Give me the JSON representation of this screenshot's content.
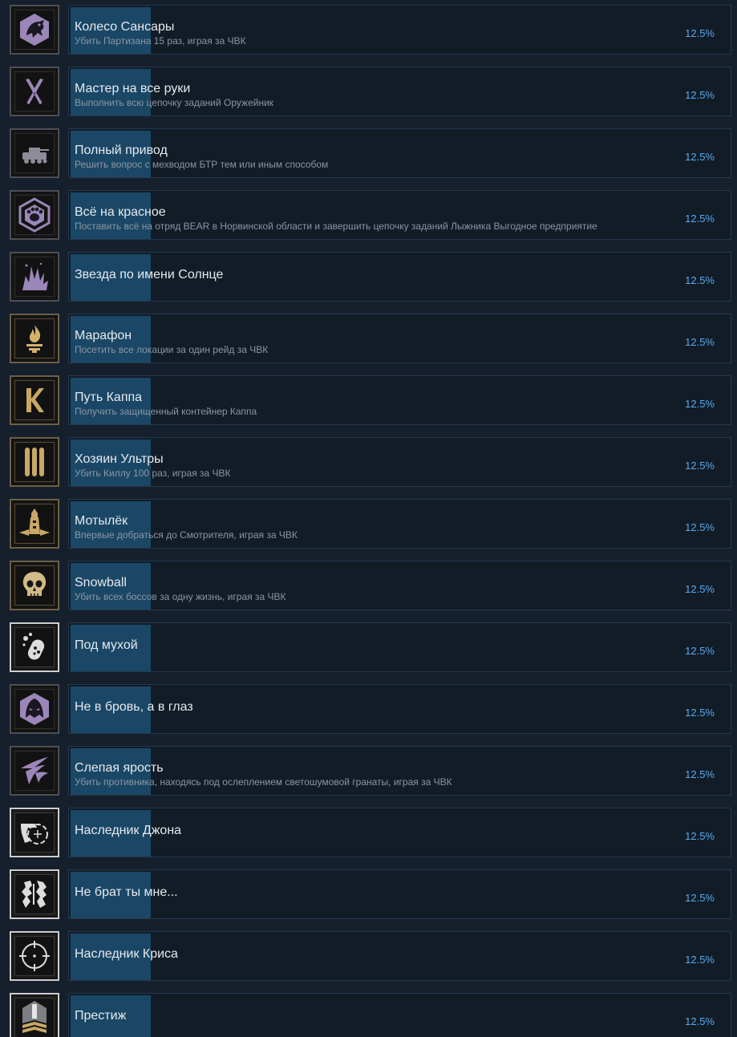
{
  "achievements": [
    {
      "title": "Колесо Сансары",
      "description": "Убить Партизана 15 раз, играя за ЧВК",
      "percent": "12.5%",
      "progress": 0.125,
      "icon": "partisan-raven-icon",
      "frame": "purple",
      "icon_color": "#9a86b8"
    },
    {
      "title": "Мастер на все руки",
      "description": "Выполнить всю цепочку заданий Оружейник",
      "percent": "12.5%",
      "progress": 0.125,
      "icon": "pliers-icon",
      "frame": "purple",
      "icon_color": "#9a86b8"
    },
    {
      "title": "Полный привод",
      "description": "Решить вопрос с мехводом БТР тем или иным способом",
      "percent": "12.5%",
      "progress": 0.125,
      "icon": "btr-vehicle-icon",
      "frame": "purple",
      "icon_color": "#8d8d99"
    },
    {
      "title": "Всё на красное",
      "description": "Поставить всё на отряд BEAR в Норвинской области и завершить цепочку заданий Лыжника Выгодное предприятие",
      "percent": "12.5%",
      "progress": 0.125,
      "icon": "bear-paw-hexagon-icon",
      "frame": "purple",
      "icon_color": "#9a86b8"
    },
    {
      "title": "Звезда по имени Солнце",
      "description": "",
      "percent": "12.5%",
      "progress": 0.125,
      "icon": "burst-explosion-icon",
      "frame": "purple",
      "icon_color": "#9a86b8"
    },
    {
      "title": "Марафон",
      "description": "Посетить все локации за один рейд за ЧВК",
      "percent": "12.5%",
      "progress": 0.125,
      "icon": "torch-flame-icon",
      "frame": "gold",
      "icon_color": "#d4b06a"
    },
    {
      "title": "Путь Каппа",
      "description": "Получить защищенный контейнер Каппа",
      "percent": "12.5%",
      "progress": 0.125,
      "icon": "kappa-icon",
      "frame": "gold",
      "icon_color": "#c8a866"
    },
    {
      "title": "Хозяин Ультры",
      "description": "Убить Киллу 100 раз, играя за ЧВК",
      "percent": "12.5%",
      "progress": 0.125,
      "icon": "triple-bars-icon",
      "frame": "gold",
      "icon_color": "#c8a866"
    },
    {
      "title": "Мотылёк",
      "description": "Впервые добраться до Смотрителя, играя за ЧВК",
      "percent": "12.5%",
      "progress": 0.125,
      "icon": "lighthouse-icon",
      "frame": "gold",
      "icon_color": "#c8a866"
    },
    {
      "title": "Snowball",
      "description": "Убить всех боссов за одну жизнь, играя за ЧВК",
      "percent": "12.5%",
      "progress": 0.125,
      "icon": "skull-icon",
      "frame": "gold",
      "icon_color": "#d2bb88"
    },
    {
      "title": "Под мухой",
      "description": "",
      "percent": "12.5%",
      "progress": 0.125,
      "icon": "pill-bubbles-icon",
      "frame": "silver",
      "icon_color": "#dcdcdc"
    },
    {
      "title": "Не в бровь, а в глаз",
      "description": "",
      "percent": "12.5%",
      "progress": 0.125,
      "icon": "hooded-face-hexagon-icon",
      "frame": "purple",
      "icon_color": "#9a86b8"
    },
    {
      "title": "Слепая ярость",
      "description": "Убить противника, находясь под ослеплением светошумовой гранаты, играя за ЧВК",
      "percent": "12.5%",
      "progress": 0.125,
      "icon": "claw-strike-icon",
      "frame": "purple",
      "icon_color": "#9a86b8"
    },
    {
      "title": "Наследник Джона",
      "description": "",
      "percent": "12.5%",
      "progress": 0.125,
      "icon": "pistol-crosshair-icon",
      "frame": "silver",
      "icon_color": "#dcdcdc"
    },
    {
      "title": "Не брат ты мне...",
      "description": "",
      "percent": "12.5%",
      "progress": 0.125,
      "icon": "torn-emblem-icon",
      "frame": "silver",
      "icon_color": "#dcdcdc"
    },
    {
      "title": "Наследник Криса",
      "description": "",
      "percent": "12.5%",
      "progress": 0.125,
      "icon": "sniper-scope-icon",
      "frame": "silver",
      "icon_color": "#dcdcdc"
    },
    {
      "title": "Престиж",
      "description": "",
      "percent": "12.5%",
      "progress": 0.125,
      "icon": "prestige-chevrons-icon",
      "frame": "silver",
      "icon_color": "#c8a866"
    }
  ]
}
